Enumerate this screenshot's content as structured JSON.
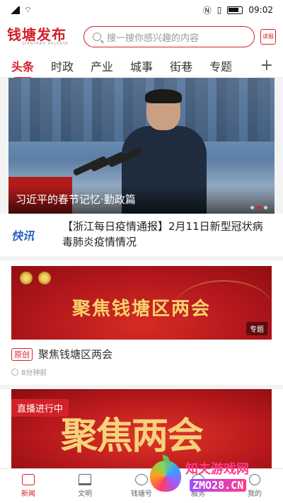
{
  "status": {
    "time": "09:02"
  },
  "header": {
    "logo_text": "钱塘发布",
    "search_placeholder": "搜一搜你感兴趣的内容",
    "report_label": "读报"
  },
  "tabs": [
    {
      "label": "头条"
    },
    {
      "label": "时政"
    },
    {
      "label": "产业"
    },
    {
      "label": "城事"
    },
    {
      "label": "街巷"
    },
    {
      "label": "专题"
    }
  ],
  "hero": {
    "caption": "习近平的春节记忆·勤政篇",
    "dots": 3,
    "active_dot": 0
  },
  "kuaixun": {
    "badge": "快讯",
    "text": "【浙江每日疫情通报】2月11日新型冠状病毒肺炎疫情情况"
  },
  "cards": [
    {
      "banner_title": "聚焦钱塘区两会",
      "tag": "专题",
      "origin_label": "原创",
      "title": "聚焦钱塘区两会",
      "time": "8分钟前"
    },
    {
      "live_label": "直播进行中",
      "banner_text": "聚焦两会"
    }
  ],
  "bottom_nav": [
    {
      "label": "新闻",
      "icon": "news-icon",
      "active": true
    },
    {
      "label": "文明",
      "icon": "civilization-icon"
    },
    {
      "label": "钱塘号",
      "icon": "qiantang-icon"
    },
    {
      "label": "服务",
      "icon": "service-icon"
    },
    {
      "label": "我的",
      "icon": "profile-icon"
    }
  ],
  "watermark": {
    "line1": "知夫游戏网",
    "line2": "ZMO28.CN"
  },
  "colors": {
    "accent": "#d3212a",
    "kuaixun_blue": "#2a63c4"
  }
}
